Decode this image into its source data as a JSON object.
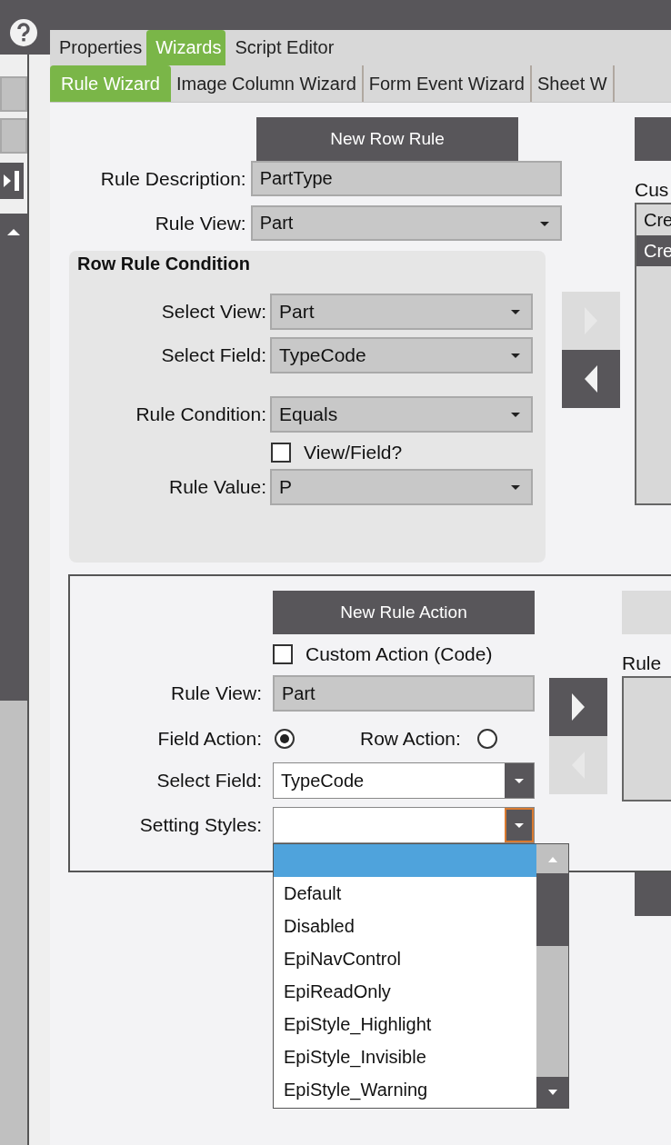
{
  "tabs": [
    {
      "label": "Properties",
      "selected": false
    },
    {
      "label": "Wizards",
      "selected": true
    },
    {
      "label": "Script Editor",
      "selected": false
    }
  ],
  "subtabs": [
    {
      "label": "Rule Wizard",
      "selected": true
    },
    {
      "label": "Image Column Wizard",
      "selected": false
    },
    {
      "label": "Form Event Wizard",
      "selected": false
    },
    {
      "label": "Sheet W",
      "selected": false
    }
  ],
  "row_rule": {
    "button": "New Row Rule",
    "description": {
      "label": "Rule Description:",
      "value": "PartType"
    },
    "rule_view": {
      "label": "Rule View:",
      "value": "Part"
    },
    "condition": {
      "title": "Row Rule Condition",
      "select_view": {
        "label": "Select View:",
        "value": "Part"
      },
      "select_field": {
        "label": "Select Field:",
        "value": "TypeCode"
      },
      "rule_condition": {
        "label": "Rule Condition:",
        "value": "Equals"
      },
      "view_field": {
        "label": "View/Field?",
        "checked": false
      },
      "rule_value": {
        "label": "Rule Value:",
        "value": "P"
      }
    }
  },
  "condition_moves": [
    {
      "kind": "right",
      "disabled": true
    },
    {
      "kind": "left",
      "disabled": false
    }
  ],
  "custom_list": {
    "label": "Cus",
    "items": [
      {
        "label": "Cre",
        "selected": false
      },
      {
        "label": "Cre",
        "selected": true
      }
    ]
  },
  "rule_action": {
    "button": "New Rule Action",
    "custom_action": {
      "label": "Custom Action (Code)",
      "checked": false
    },
    "rule_view": {
      "label": "Rule View:",
      "value": "Part"
    },
    "field_action": {
      "label": "Field Action:",
      "selected": true
    },
    "row_action": {
      "label": "Row Action:",
      "selected": false
    },
    "select_field": {
      "label": "Select Field:",
      "value": "TypeCode"
    },
    "setting_styles": {
      "label": "Setting Styles:"
    },
    "dropdown": {
      "items": [
        {
          "selected": true
        },
        {
          "label": "Default",
          "selected": false
        },
        {
          "label": "Disabled",
          "selected": false
        },
        {
          "label": "EpiNavControl",
          "selected": false
        },
        {
          "label": "EpiReadOnly",
          "selected": false
        },
        {
          "label": "EpiStyle_Highlight",
          "selected": false
        },
        {
          "label": "EpiStyle_Invisible",
          "selected": false
        },
        {
          "label": "EpiStyle_Warning",
          "selected": false
        }
      ]
    }
  },
  "action_moves": [
    {
      "kind": "right",
      "disabled": false
    },
    {
      "kind": "left",
      "disabled": true
    }
  ],
  "rule_list": {
    "label": "Rule"
  }
}
